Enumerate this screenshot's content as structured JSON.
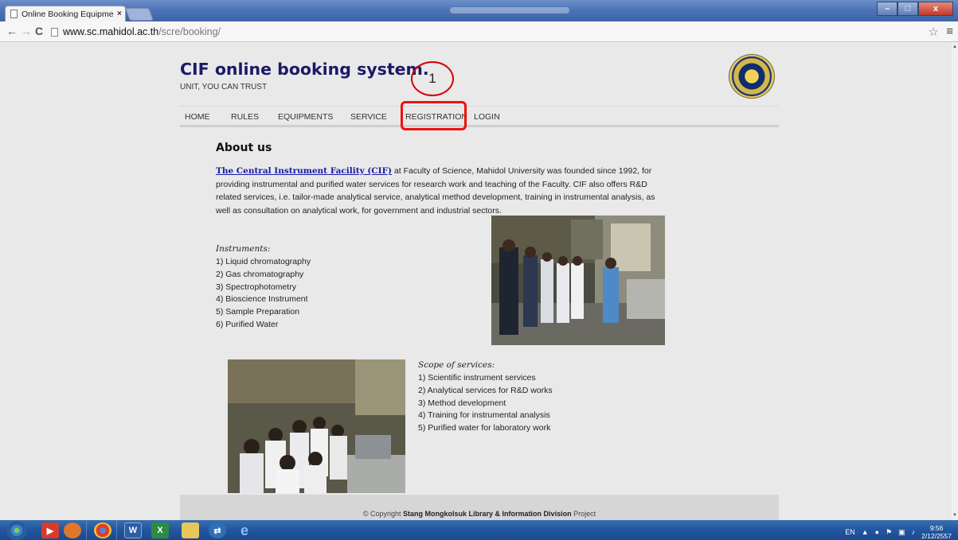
{
  "browser": {
    "tab_title": "Online Booking Equipmen",
    "url_host": "www.sc.mahidol.ac.th",
    "url_path": "/scre/booking/"
  },
  "site": {
    "title": "CIF online booking system.",
    "tagline": "UNIT, YOU CAN TRUST",
    "annotation_number": "1"
  },
  "nav": {
    "items": [
      {
        "label": "HOME"
      },
      {
        "label": "RULES"
      },
      {
        "label": "EQUIPMENTS"
      },
      {
        "label": "SERVICE"
      },
      {
        "label": "REGISTRATION"
      },
      {
        "label": "LOGIN"
      }
    ]
  },
  "about": {
    "heading": "About us",
    "link_text": "The Central Instrument Facility (CIF)",
    "intro_text": " at Faculty of Science, Mahidol University was founded since 1992, for providing instrumental and purified water services for research work and teaching of the Faculty.   CIF also offers R&D related services, i.e. tailor-made analytical service, analytical method development, training in instrumental analysis, as well as consultation on analytical work, for government and industrial sectors."
  },
  "instruments": {
    "title": "Instruments:",
    "items": [
      "1) Liquid chromatography",
      "2) Gas chromatography",
      "3) Spectrophotometry",
      "4) Bioscience Instrument",
      "5) Sample Preparation",
      "6) Purified Water"
    ]
  },
  "scope": {
    "title": "Scope of services:",
    "items": [
      "1) Scientific instrument services",
      "2) Analytical services for R&D works",
      "3) Method development",
      "4) Training for instrumental analysis",
      "5) Purified water for laboratory work"
    ]
  },
  "footer": {
    "prefix": "© Copyright ",
    "bold": "Stang Mongkolsuk Library & Information Division",
    "suffix": " Project"
  },
  "taskbar": {
    "lang": "EN",
    "time": "9:56",
    "date": "2/12/2557"
  }
}
